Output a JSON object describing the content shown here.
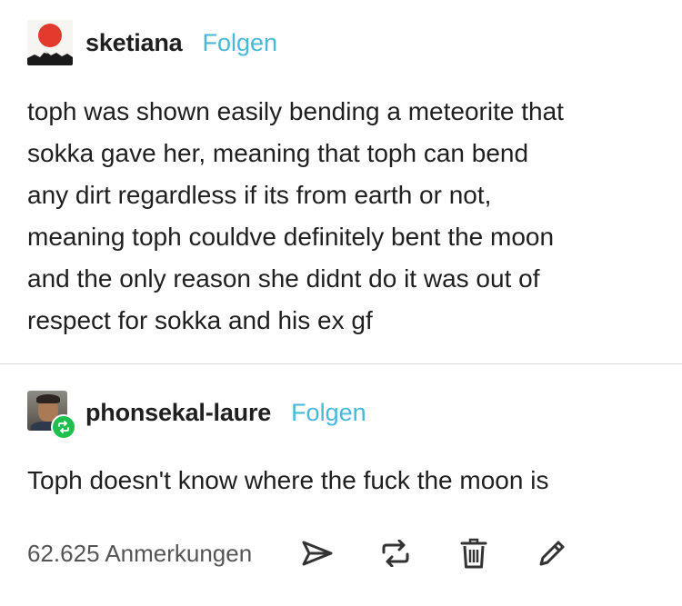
{
  "post": {
    "author": "sketiana",
    "follow_label": "Folgen",
    "body_lines": [
      "toph was shown easily bending a meteorite that",
      "sokka gave her, meaning that toph can bend",
      "any dirt regardless if its from earth or not,",
      "meaning toph couldve definitely bent the moon",
      "and the only reason she didnt do it was out of",
      "respect for sokka and his ex gf"
    ]
  },
  "reply": {
    "author": "phonsekal-laure",
    "follow_label": "Folgen",
    "body": "Toph doesn't know where the fuck the moon is"
  },
  "footer": {
    "notes_label": "62.625 Anmerkungen",
    "icons": [
      "share-icon",
      "reblog-icon",
      "delete-icon",
      "edit-icon"
    ]
  },
  "colors": {
    "follow": "#49b8d6",
    "reblog_badge": "#1fbf4f",
    "text": "#1f1f1f",
    "muted": "#555555"
  }
}
